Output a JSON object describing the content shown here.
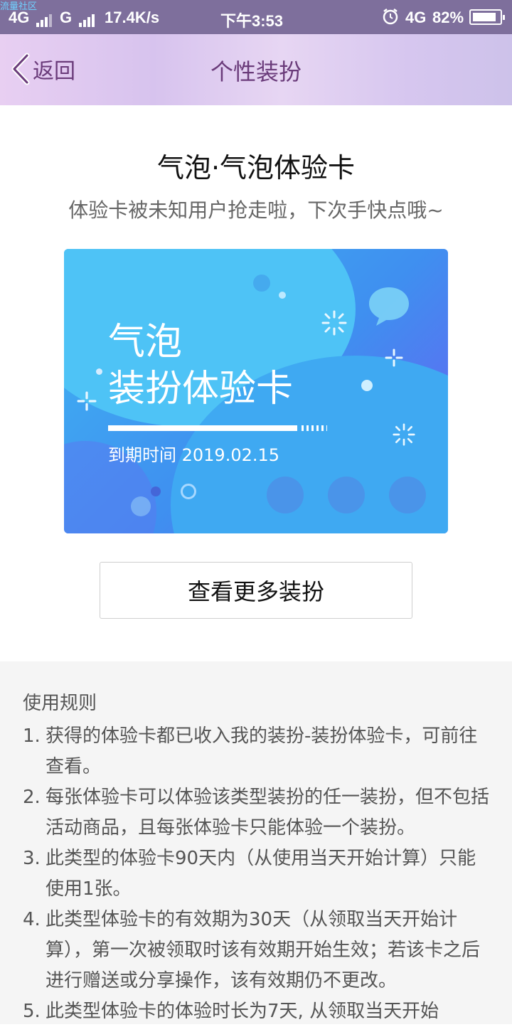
{
  "status_bar": {
    "watermark": "流量社区",
    "network1": "4G",
    "network2": "G",
    "speed": "17.4K/s",
    "time": "下午3:53",
    "network3": "4G",
    "battery": "82%"
  },
  "nav": {
    "back_label": "返回",
    "title": "个性装扮"
  },
  "header": {
    "title": "气泡·气泡体验卡",
    "subtitle": "体验卡被未知用户抢走啦，下次手快点哦~"
  },
  "card": {
    "line1": "气泡",
    "line2": "装扮体验卡",
    "expire": "到期时间 2019.02.15"
  },
  "more_button": "查看更多装扮",
  "rules": {
    "heading": "使用规则",
    "items": [
      {
        "num": "1.",
        "text": "获得的体验卡都已收入我的装扮-装扮体验卡，可前往查看。"
      },
      {
        "num": "2.",
        "text": "每张体验卡可以体验该类型装扮的任一装扮，但不包括活动商品，且每张体验卡只能体验一个装扮。"
      },
      {
        "num": "3.",
        "text": "此类型的体验卡90天内（从使用当天开始计算）只能使用1张。"
      },
      {
        "num": "4.",
        "text": "此类型体验卡的有效期为30天（从领取当天开始计算），第一次被领取时该有效期开始生效；若该卡之后进行赠送或分享操作，该有效期仍不更改。"
      },
      {
        "num": "5.",
        "text": "此类型体验卡的体验时长为7天, 从领取当天开始"
      }
    ]
  }
}
